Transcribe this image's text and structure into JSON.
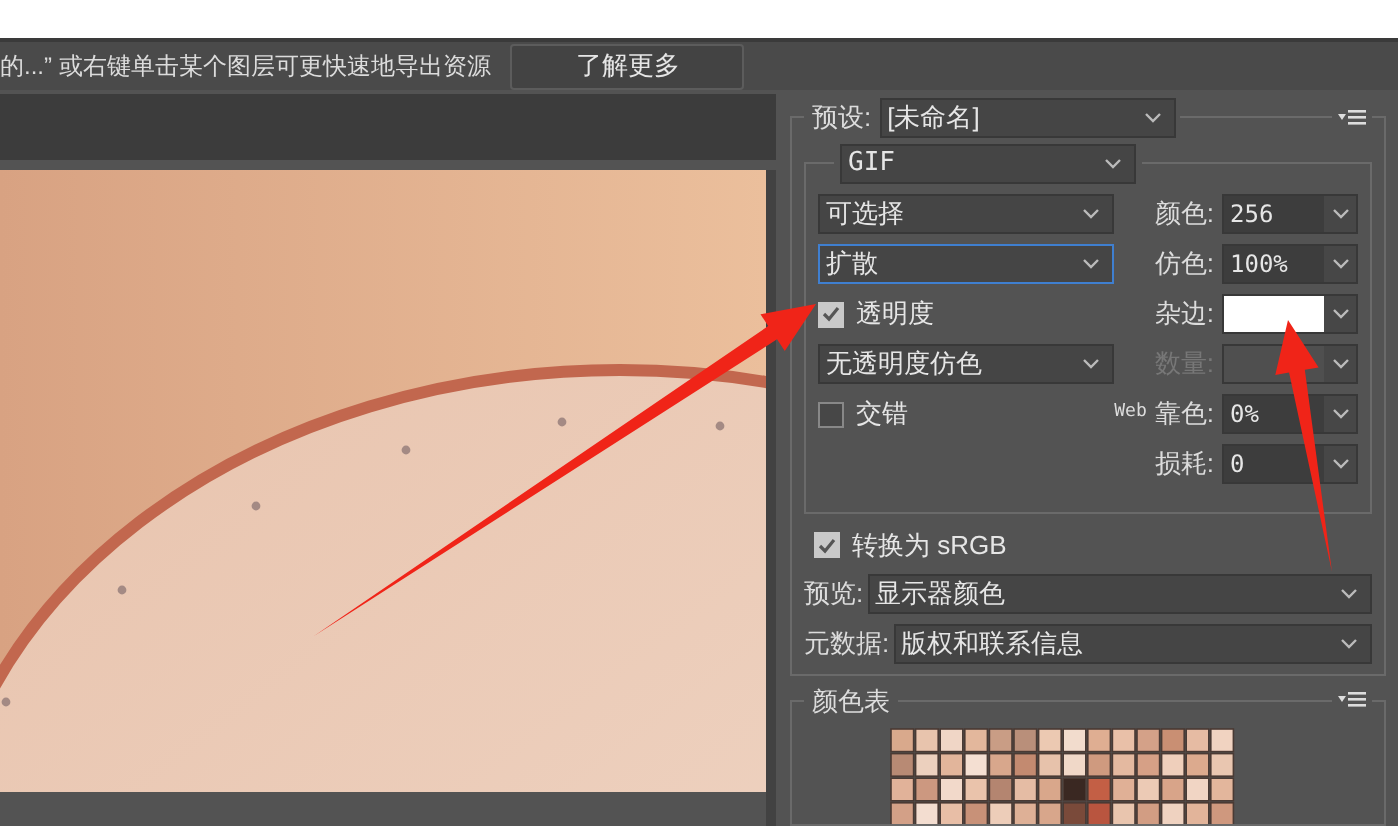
{
  "top_bar": {
    "hint": "的...” 或右键单击某个图层可更快速地导出资源",
    "learn_more_button": "了解更多"
  },
  "settings": {
    "preset": {
      "label": "预设:",
      "value": "[未命名]"
    },
    "format": "GIF",
    "reduction": "可选择",
    "dither_algorithm": {
      "value": "扩散",
      "focused": true
    },
    "colors": {
      "label": "颜色:",
      "value": "256"
    },
    "dither": {
      "label": "仿色:",
      "value": "100%"
    },
    "transparency": {
      "label": "透明度",
      "checked": true
    },
    "matte": {
      "label": "杂边:"
    },
    "transparency_dither": "无透明度仿色",
    "amount": {
      "label": "数量:",
      "disabled": true
    },
    "interlaced": {
      "label": "交错",
      "checked": false
    },
    "web_snap": {
      "label_prefix": "Web",
      "label": "靠色:",
      "value": "0%"
    },
    "lossy": {
      "label": "损耗:",
      "value": "0"
    }
  },
  "convert_srgb": {
    "label": "转换为 sRGB",
    "checked": true
  },
  "preview": {
    "label": "预览:",
    "value": "显示器颜色"
  },
  "metadata": {
    "label": "元数据:",
    "value": "版权和联系信息"
  },
  "color_table": {
    "title": "颜色表"
  }
}
